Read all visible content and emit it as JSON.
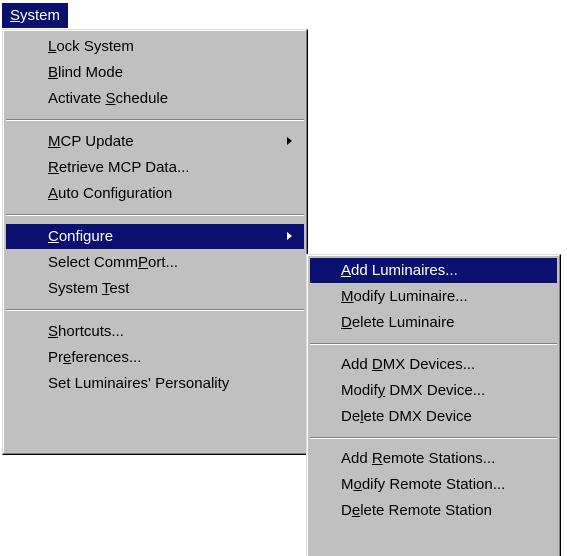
{
  "menubar": {
    "title": "System",
    "mnemonic": "S",
    "rest": "ystem"
  },
  "system_menu": {
    "groups": [
      [
        {
          "label": "Lock System",
          "pre": "",
          "mn": "L",
          "post": "ock System"
        },
        {
          "label": "Blind Mode",
          "pre": "",
          "mn": "B",
          "post": "lind Mode"
        },
        {
          "label": "Activate Schedule",
          "pre": "Activate ",
          "mn": "S",
          "post": "chedule"
        }
      ],
      [
        {
          "label": "MCP Update",
          "pre": "",
          "mn": "M",
          "post": "CP Update",
          "submenu": true
        },
        {
          "label": "Retrieve MCP Data...",
          "pre": "",
          "mn": "R",
          "post": "etrieve MCP Data..."
        },
        {
          "label": "Auto Configuration",
          "pre": "",
          "mn": "A",
          "post": "uto Configuration"
        }
      ],
      [
        {
          "label": "Configure",
          "pre": "",
          "mn": "C",
          "post": "onfigure",
          "submenu": true,
          "highlighted": true
        },
        {
          "label": "Select CommPort...",
          "pre": "Select Comm",
          "mn": "P",
          "post": "ort..."
        },
        {
          "label": "System Test",
          "pre": "System ",
          "mn": "T",
          "post": "est"
        }
      ],
      [
        {
          "label": "Shortcuts...",
          "pre": "",
          "mn": "S",
          "post": "hortcuts..."
        },
        {
          "label": "Preferences...",
          "pre": "Pr",
          "mn": "e",
          "post": "ferences..."
        },
        {
          "label": "Set Luminaires' Personality",
          "pre": "Set Luminaires' Personality",
          "mn": "",
          "post": ""
        }
      ]
    ]
  },
  "configure_submenu": {
    "groups": [
      [
        {
          "label": "Add Luminaires...",
          "pre": "",
          "mn": "A",
          "post": "dd Luminaires...",
          "highlighted": true
        },
        {
          "label": "Modify Luminaire...",
          "pre": "",
          "mn": "M",
          "post": "odify Luminaire..."
        },
        {
          "label": "Delete Luminaire",
          "pre": "",
          "mn": "D",
          "post": "elete Luminaire"
        }
      ],
      [
        {
          "label": "Add DMX Devices...",
          "pre": "Add ",
          "mn": "D",
          "post": "MX Devices..."
        },
        {
          "label": "Modify DMX Device...",
          "pre": "Modif",
          "mn": "y",
          "post": " DMX Device..."
        },
        {
          "label": "Delete DMX Device",
          "pre": "De",
          "mn": "l",
          "post": "ete DMX Device"
        }
      ],
      [
        {
          "label": "Add Remote Stations...",
          "pre": "Add ",
          "mn": "R",
          "post": "emote Stations..."
        },
        {
          "label": "Modify Remote Station...",
          "pre": "M",
          "mn": "o",
          "post": "dify Remote Station..."
        },
        {
          "label": "Delete Remote Station",
          "pre": "D",
          "mn": "e",
          "post": "lete Remote Station"
        }
      ]
    ]
  }
}
